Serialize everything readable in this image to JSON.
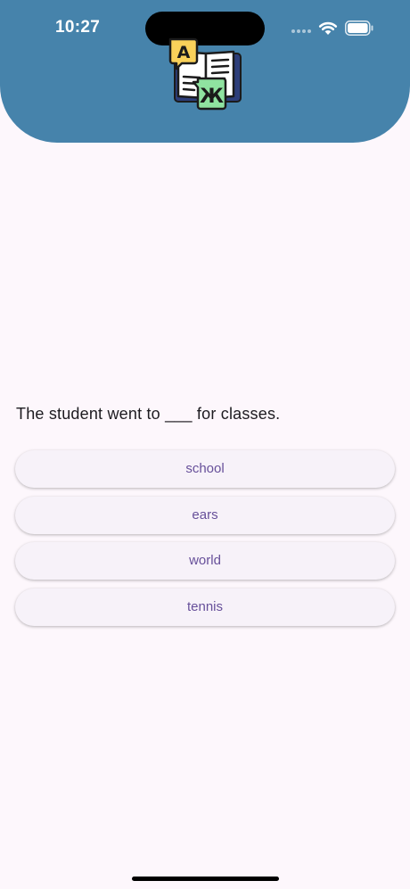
{
  "status_bar": {
    "time": "10:27",
    "icons": [
      "cellular-signal-icon",
      "wifi-icon",
      "battery-icon"
    ]
  },
  "header": {
    "background_color": "#4683ab",
    "logo": {
      "icon": "language-book-icon",
      "glyph_left": "A",
      "glyph_right": "Ж"
    }
  },
  "quiz": {
    "question": "The student went to ___ for classes.",
    "options": [
      "school",
      "ears",
      "world",
      "tennis"
    ]
  },
  "colors": {
    "page_background": "#fdf7fc",
    "option_text": "#67509a",
    "option_background": "#f7f2f9"
  }
}
